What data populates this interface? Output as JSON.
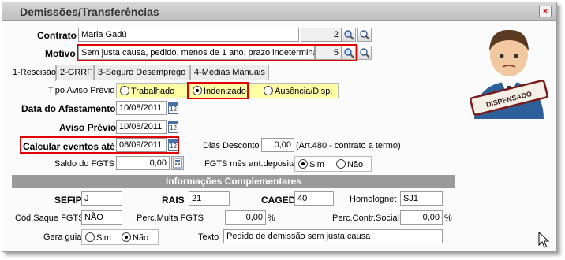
{
  "window": {
    "title": "Demissões/Transferências",
    "close_label": "×"
  },
  "header": {
    "contrato_label": "Contrato",
    "contrato_value": "Maria Gadú",
    "contrato_code": "2",
    "motivo_label": "Motivo",
    "motivo_value": "Sem justa causa, pedido, menos de 1 ano, prazo indetermina",
    "motivo_code": "5"
  },
  "tabs": [
    {
      "label": "1-Rescisão"
    },
    {
      "label": "2-GRRF"
    },
    {
      "label": "3-Seguro Desemprego"
    },
    {
      "label": "4-Médias Manuais"
    }
  ],
  "rescisao": {
    "tipo_aviso_label": "Tipo Aviso Prévio",
    "tipo_aviso_options": [
      "Trabalhado",
      "Indenizado",
      "Ausência/Disp."
    ],
    "tipo_aviso_selected": "Indenizado",
    "data_afastamento_label": "Data do Afastamento",
    "data_afastamento_value": "10/08/2011",
    "aviso_previo_label": "Aviso Prévio",
    "aviso_previo_value": "10/08/2011",
    "calcular_label": "Calcular eventos até",
    "calcular_value": "08/09/2011",
    "calendar_icon_text": "12",
    "dias_desconto_label": "Dias Desconto",
    "dias_desconto_value": "0,00",
    "dias_desconto_note": "(Art.480 - contrato a termo)",
    "saldo_fgts_label": "Saldo do FGTS",
    "saldo_fgts_value": "0,00",
    "fgts_mes_label": "FGTS mês ant.depositado",
    "fgts_mes_options": [
      "Sim",
      "Não"
    ],
    "fgts_mes_selected": "Sim"
  },
  "info": {
    "section_title": "Informações Complementares",
    "sefip_label": "SEFIP",
    "sefip_value": "J",
    "rais_label": "RAIS",
    "rais_value": "21",
    "caged_label": "CAGED",
    "caged_value": "40",
    "homolognet_label": "Homolognet",
    "homolognet_value": "SJ1",
    "cod_saque_label": "Cód.Saque FGTS",
    "cod_saque_value": "NÃO",
    "perc_multa_label": "Perc.Multa FGTS",
    "perc_multa_value": "0,00",
    "perc_multa_unit": "%",
    "perc_contr_label": "Perc.Contr.Social",
    "perc_contr_value": "0,00",
    "perc_contr_unit": "%",
    "gera_guia_label": "Gera guia",
    "gera_guia_options": [
      "Sim",
      "Não"
    ],
    "gera_guia_selected": "Não",
    "texto_label": "Texto",
    "texto_value": "Pedido de demissão sem justa causa"
  },
  "stamp": {
    "text": "DISPENSADO"
  },
  "colors": {
    "highlight": "#e00000",
    "radio_group_bg": "#ffffa6",
    "section_bar": "#9a9a9a"
  }
}
